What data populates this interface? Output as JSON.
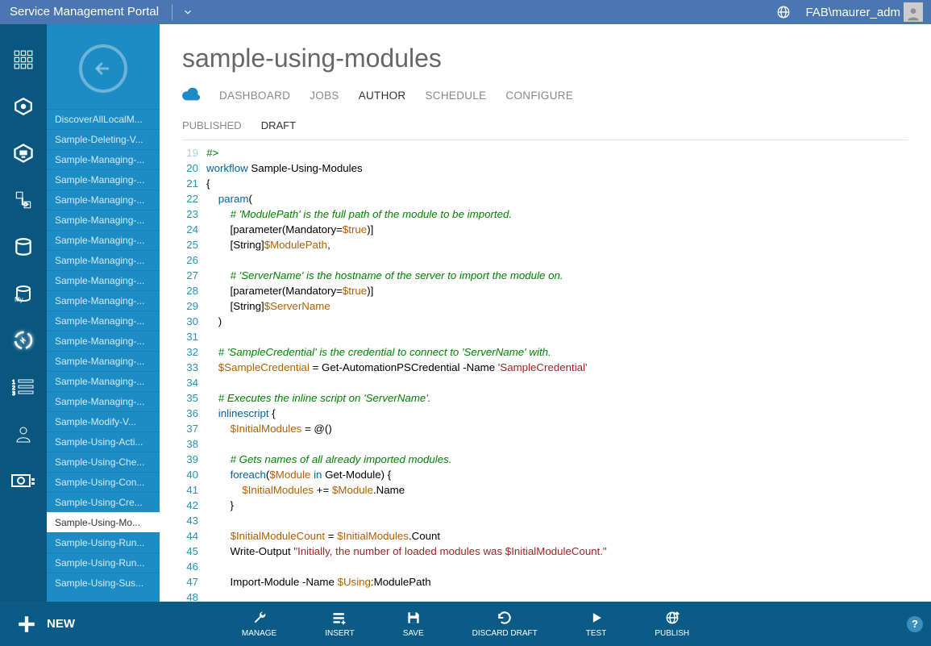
{
  "header": {
    "title": "Service Management Portal",
    "username": "FAB\\maurer_adm"
  },
  "rail_icons": [
    "grid",
    "target",
    "monitor",
    "transfer",
    "sql",
    "mysql",
    "automation",
    "list",
    "user",
    "billing"
  ],
  "rail_active_index": 6,
  "back_label": "back",
  "sidebar_items": [
    "DiscoverAllLocalM...",
    "Sample-Deleting-V...",
    "Sample-Managing-...",
    "Sample-Managing-...",
    "Sample-Managing-...",
    "Sample-Managing-...",
    "Sample-Managing-...",
    "Sample-Managing-...",
    "Sample-Managing-...",
    "Sample-Managing-...",
    "Sample-Managing-...",
    "Sample-Managing-...",
    "Sample-Managing-...",
    "Sample-Managing-...",
    "Sample-Managing-...",
    "Sample-Modify-V...",
    "Sample-Using-Acti...",
    "Sample-Using-Che...",
    "Sample-Using-Con...",
    "Sample-Using-Cre...",
    "Sample-Using-Mo...",
    "Sample-Using-Run...",
    "Sample-Using-Run...",
    "Sample-Using-Sus..."
  ],
  "sidebar_selected_index": 20,
  "page_title": "sample-using-modules",
  "primary_tabs": [
    "DASHBOARD",
    "JOBS",
    "AUTHOR",
    "SCHEDULE",
    "CONFIGURE"
  ],
  "primary_active_index": 2,
  "secondary_tabs": [
    "PUBLISHED",
    "DRAFT"
  ],
  "secondary_active_index": 1,
  "code_start_line": 19,
  "code_lines": [
    {
      "t": [
        {
          "c": "cm",
          "s": "#>"
        }
      ]
    },
    {
      "t": [
        {
          "c": "kw",
          "s": "workflow"
        },
        {
          "c": "",
          "s": " Sample-Using-Modules"
        }
      ]
    },
    {
      "t": [
        {
          "c": "",
          "s": "{"
        }
      ]
    },
    {
      "t": [
        {
          "c": "",
          "s": "    "
        },
        {
          "c": "kw",
          "s": "param"
        },
        {
          "c": "",
          "s": "("
        }
      ]
    },
    {
      "t": [
        {
          "c": "",
          "s": "        "
        },
        {
          "c": "cm",
          "s": "# 'ModulePath' is the full path of the module to be imported."
        }
      ]
    },
    {
      "t": [
        {
          "c": "",
          "s": "        [parameter(Mandatory="
        },
        {
          "c": "var",
          "s": "$true"
        },
        {
          "c": "",
          "s": ")]"
        }
      ]
    },
    {
      "t": [
        {
          "c": "",
          "s": "        [String]"
        },
        {
          "c": "var",
          "s": "$ModulePath"
        },
        {
          "c": "",
          "s": ","
        }
      ]
    },
    {
      "t": [
        {
          "c": "",
          "s": ""
        }
      ]
    },
    {
      "t": [
        {
          "c": "",
          "s": "        "
        },
        {
          "c": "cm",
          "s": "# 'ServerName' is the hostname of the server to import the module on."
        }
      ]
    },
    {
      "t": [
        {
          "c": "",
          "s": "        [parameter(Mandatory="
        },
        {
          "c": "var",
          "s": "$true"
        },
        {
          "c": "",
          "s": ")]"
        }
      ]
    },
    {
      "t": [
        {
          "c": "",
          "s": "        [String]"
        },
        {
          "c": "var",
          "s": "$ServerName"
        }
      ]
    },
    {
      "t": [
        {
          "c": "",
          "s": "    )"
        }
      ]
    },
    {
      "t": [
        {
          "c": "",
          "s": ""
        }
      ]
    },
    {
      "t": [
        {
          "c": "",
          "s": "    "
        },
        {
          "c": "cm",
          "s": "# 'SampleCredential' is the credential to connect to 'ServerName' with."
        }
      ]
    },
    {
      "t": [
        {
          "c": "",
          "s": "    "
        },
        {
          "c": "var",
          "s": "$SampleCredential"
        },
        {
          "c": "",
          "s": " = Get-AutomationPSCredential -Name "
        },
        {
          "c": "str",
          "s": "'SampleCredential'"
        }
      ]
    },
    {
      "t": [
        {
          "c": "",
          "s": ""
        }
      ]
    },
    {
      "t": [
        {
          "c": "",
          "s": "    "
        },
        {
          "c": "cm",
          "s": "# Executes the inline script on 'ServerName'."
        }
      ]
    },
    {
      "t": [
        {
          "c": "",
          "s": "    "
        },
        {
          "c": "kw",
          "s": "inlinescript"
        },
        {
          "c": "",
          "s": " {"
        }
      ]
    },
    {
      "t": [
        {
          "c": "",
          "s": "        "
        },
        {
          "c": "var",
          "s": "$InitialModules"
        },
        {
          "c": "",
          "s": " = @()"
        }
      ]
    },
    {
      "t": [
        {
          "c": "",
          "s": ""
        }
      ]
    },
    {
      "t": [
        {
          "c": "",
          "s": "        "
        },
        {
          "c": "cm",
          "s": "# Gets names of all already imported modules."
        }
      ]
    },
    {
      "t": [
        {
          "c": "",
          "s": "        "
        },
        {
          "c": "kw",
          "s": "foreach"
        },
        {
          "c": "",
          "s": "("
        },
        {
          "c": "var",
          "s": "$Module"
        },
        {
          "c": "",
          "s": " "
        },
        {
          "c": "kw",
          "s": "in"
        },
        {
          "c": "",
          "s": " Get-Module) {"
        }
      ]
    },
    {
      "t": [
        {
          "c": "",
          "s": "            "
        },
        {
          "c": "var",
          "s": "$InitialModules"
        },
        {
          "c": "",
          "s": " += "
        },
        {
          "c": "var",
          "s": "$Module"
        },
        {
          "c": "",
          "s": ".Name"
        }
      ]
    },
    {
      "t": [
        {
          "c": "",
          "s": "        }"
        }
      ]
    },
    {
      "t": [
        {
          "c": "",
          "s": ""
        }
      ]
    },
    {
      "t": [
        {
          "c": "",
          "s": "        "
        },
        {
          "c": "var",
          "s": "$InitialModuleCount"
        },
        {
          "c": "",
          "s": " = "
        },
        {
          "c": "var",
          "s": "$InitialModules"
        },
        {
          "c": "",
          "s": ".Count"
        }
      ]
    },
    {
      "t": [
        {
          "c": "",
          "s": "        Write-Output "
        },
        {
          "c": "str",
          "s": "\"Initially, the number of loaded modules was $InitialModuleCount.\""
        }
      ]
    },
    {
      "t": [
        {
          "c": "",
          "s": ""
        }
      ]
    },
    {
      "t": [
        {
          "c": "",
          "s": "        Import-Module -Name "
        },
        {
          "c": "var",
          "s": "$Using"
        },
        {
          "c": "",
          "s": ":ModulePath"
        }
      ]
    },
    {
      "t": [
        {
          "c": "",
          "s": ""
        }
      ]
    }
  ],
  "footer": {
    "new_label": "NEW",
    "actions": [
      {
        "label": "MANAGE",
        "icon": "wrench"
      },
      {
        "label": "INSERT",
        "icon": "list-plus"
      },
      {
        "label": "SAVE",
        "icon": "floppy"
      },
      {
        "label": "DISCARD DRAFT",
        "icon": "undo"
      },
      {
        "label": "TEST",
        "icon": "play"
      },
      {
        "label": "PUBLISH",
        "icon": "globe-up"
      }
    ],
    "help_label": "?"
  }
}
